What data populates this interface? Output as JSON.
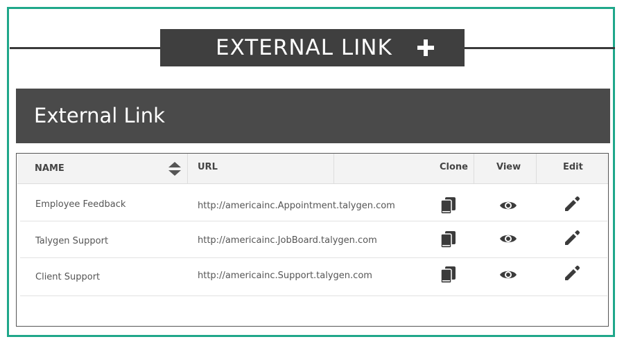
{
  "banner": {
    "title": "EXTERNAL LINK",
    "add_icon": "plus-icon"
  },
  "section": {
    "title": "External Link"
  },
  "table": {
    "columns": {
      "name": "NAME",
      "url": "URL",
      "clone": "Clone",
      "view": "View",
      "edit": "Edit"
    },
    "sort_icon": "sort-icon",
    "rows": [
      {
        "name": "Employee Feedback",
        "url": "http://americainc.Appointment.talygen.com"
      },
      {
        "name": "Talygen Support",
        "url": "http://americainc.JobBoard.talygen.com"
      },
      {
        "name": "Client Support",
        "url": "http://americainc.Support.talygen.com"
      }
    ],
    "row_icons": {
      "clone": "clone-icon",
      "view": "eye-icon",
      "edit": "pencil-icon"
    }
  },
  "colors": {
    "frame_border": "#1fa78a",
    "banner_bg": "#3f3f3f",
    "header_bg": "#4a4a4a"
  }
}
